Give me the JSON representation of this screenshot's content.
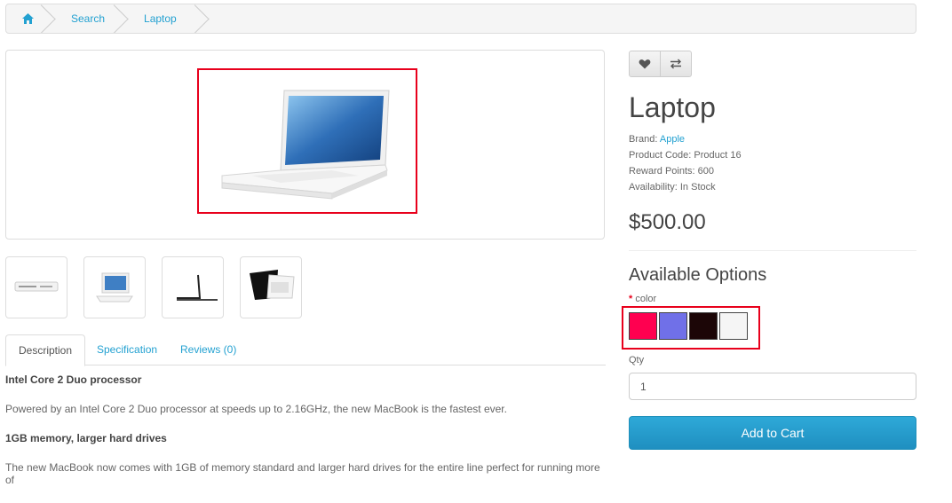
{
  "breadcrumb": {
    "home_icon": "home-icon",
    "items": [
      "Search",
      "Laptop"
    ]
  },
  "product": {
    "title": "Laptop",
    "brand_label": "Brand:",
    "brand": "Apple",
    "code": "Product Code: Product 16",
    "reward": "Reward Points: 600",
    "availability": "Availability: In Stock",
    "price": "$500.00"
  },
  "actions": {
    "wishlist_icon": "heart-icon",
    "compare_icon": "compare-icon"
  },
  "tabs": [
    "Description",
    "Specification",
    "Reviews (0)"
  ],
  "description": {
    "h1": "Intel Core 2 Duo processor",
    "p1": "Powered by an Intel Core 2 Duo processor at speeds up to 2.16GHz, the new MacBook is the fastest ever.",
    "h2": "1GB memory, larger hard drives",
    "p2": "The new MacBook now comes with 1GB of memory standard and larger hard drives for the entire line perfect for running more of"
  },
  "options": {
    "title": "Available Options",
    "required_mark": "*",
    "color_label": "color",
    "swatches": [
      "#ff0050",
      "#7070e8",
      "#1c0607",
      "#f5f5f5"
    ]
  },
  "qty": {
    "label": "Qty",
    "value": "1"
  },
  "cart_button": "Add to Cart",
  "colors": {
    "accent": "#23a1d1",
    "highlight": "#e8001c",
    "cart": "#2ea9d8"
  }
}
